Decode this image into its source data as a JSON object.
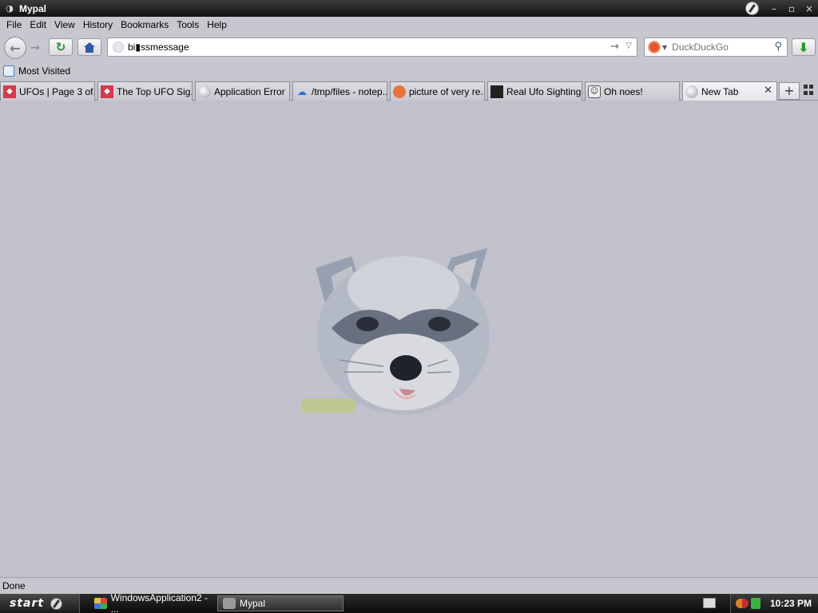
{
  "window": {
    "title": "Mypal",
    "controls": [
      "–",
      "▫",
      "×"
    ]
  },
  "menu": [
    "File",
    "Edit",
    "View",
    "History",
    "Bookmarks",
    "Tools",
    "Help"
  ],
  "nav": {
    "url": "bi▮ssmessage",
    "search_placeholder": "DuckDuckGo"
  },
  "bookmarks": {
    "most_visited": "Most Visited"
  },
  "tabs": [
    {
      "label": "UFOs | Page 3 of...",
      "icon": "red-shield-icon"
    },
    {
      "label": "The Top UFO Sig...",
      "icon": "red-shield-icon"
    },
    {
      "label": "Application Error",
      "icon": "globe-icon"
    },
    {
      "label": "/tmp/files - notep...",
      "icon": "cloud-icon"
    },
    {
      "label": "picture of very re...",
      "icon": "duckduckgo-icon"
    },
    {
      "label": "Real Ufo Sighting...",
      "icon": "dark-photo-icon"
    },
    {
      "label": "Oh noes!",
      "icon": "face-icon"
    },
    {
      "label": "New Tab",
      "icon": "globe-icon",
      "selected": true
    }
  ],
  "status": {
    "text": "Done"
  },
  "taskbar": {
    "start_label": "start",
    "tasks": [
      {
        "label": "WindowsApplication2 - ..."
      },
      {
        "label": "Mypal",
        "active": true
      }
    ],
    "clock": "10:23 PM"
  }
}
